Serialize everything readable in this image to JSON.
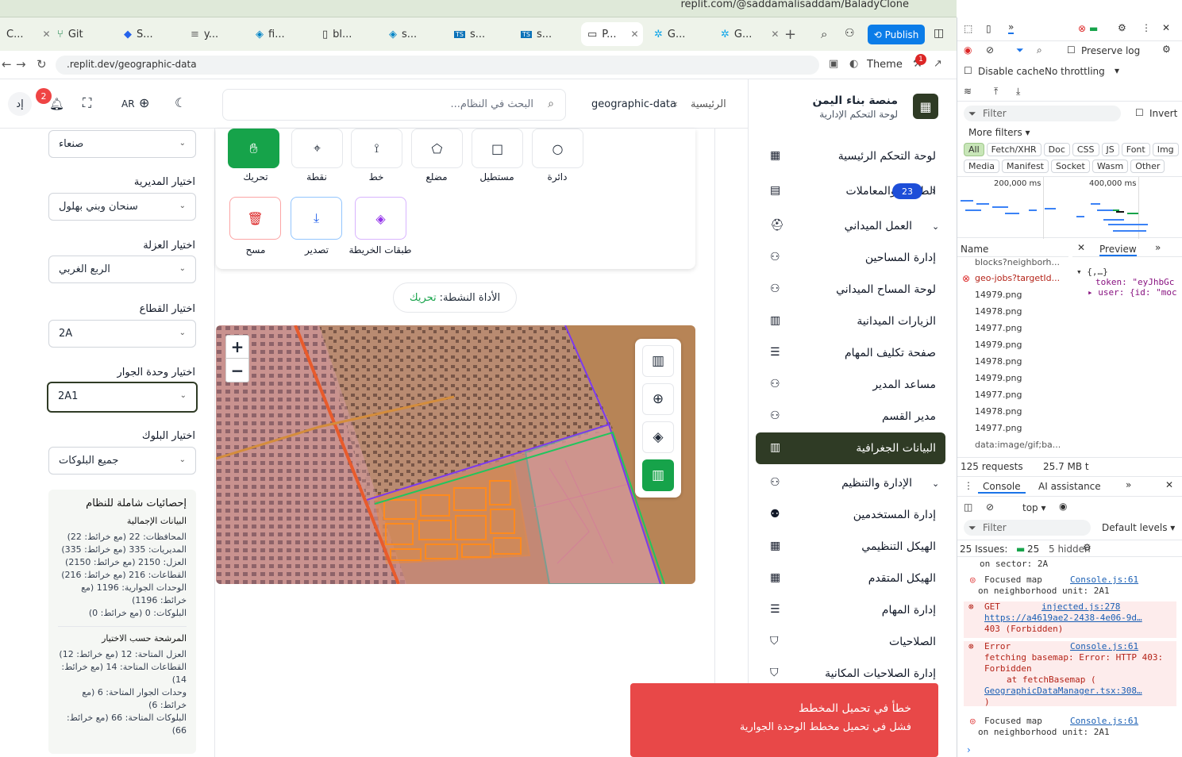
{
  "browser": {
    "url_top": "replit.com/@saddamalisaddam/BaladyClone",
    "tabs": [
      {
        "label": "C..."
      },
      {
        "label": "Git"
      },
      {
        "label": "S..."
      },
      {
        "label": "y..."
      },
      {
        "label": "fi..."
      },
      {
        "label": "bl..."
      },
      {
        "label": "s..."
      },
      {
        "label": "s..."
      },
      {
        "label": "s..."
      },
      {
        "label": "P..."
      },
      {
        "label": "G..."
      },
      {
        "label": "G..."
      }
    ],
    "publish": "Publish",
    "address": ".replit.dev/geographic-data",
    "theme": "Theme",
    "badge": "1"
  },
  "header": {
    "breadcrumb_home": "الرئيسية",
    "breadcrumb_current": "geographic-data",
    "search_placeholder": "البحث في النظام...",
    "lang": "AR",
    "notif_count": "2",
    "avatar": "إد"
  },
  "sidebar": {
    "brand_title": "منصة بناء اليمن",
    "brand_sub": "لوحة التحكم الإدارية",
    "items": [
      {
        "label": "لوحة التحكم الرئيسية"
      },
      {
        "label": "الطلبات والمعاملات",
        "badge": "23"
      },
      {
        "label": "العمل الميداني"
      },
      {
        "label": "إدارة المساحين"
      },
      {
        "label": "لوحة المساح الميداني"
      },
      {
        "label": "الزيارات الميدانية"
      },
      {
        "label": "صفحة تكليف المهام"
      },
      {
        "label": "مساعد المدير"
      },
      {
        "label": "مدير القسم"
      },
      {
        "label": "البيانات الجغرافية"
      },
      {
        "label": "الإدارة والتنظيم"
      },
      {
        "label": "إدارة المستخدمين"
      },
      {
        "label": "الهيكل التنظيمي"
      },
      {
        "label": "الهيكل المتقدم"
      },
      {
        "label": "إدارة المهام"
      },
      {
        "label": "الصلاحيات"
      },
      {
        "label": "إدارة الصلاحيات المكانية"
      }
    ]
  },
  "filters": {
    "governorate_value": "صنعاء",
    "district_label": "اختيار المديرية",
    "district_value": "سنحان وبني بهلول",
    "uzla_label": "اختيار العزلة",
    "uzla_value": "الربع الغربي",
    "sector_label": "اختيار القطاع",
    "sector_value": "2A",
    "unit_label": "اختيار وحدة الجوار",
    "unit_value": "2A1",
    "block_label": "اختيار البلوك",
    "block_value": "جميع البلوكات"
  },
  "stats": {
    "title": "إحصائيات شاملة للنظام",
    "total_title": "البيانات الإجمالية",
    "total_lines": [
      "المحافظات: 22 (مع خرائط: 22)",
      "المديريات: 335 (مع خرائط: 335)",
      "العزل: 2150 (مع خرائط: 2150)",
      "القطاعات: 216 (مع خرائط: 216)",
      "الوحدات الجوارية: 1196 (مع خرائط: 1196)",
      "البلوكات: 0 (مع خرائط: 0)"
    ],
    "filtered_title": "المرشحة حسب الاختيار",
    "filtered_lines": [
      "العزل المتاحة: 12 (مع خرائط: 12)",
      "القطاعات المتاحة: 14 (مع خرائط: 14)",
      "وحدات الجوار المتاحة: 6 (مع خرائط: 6)",
      "البلوكات المتاحة: 66 (مع خرائط: 66)"
    ]
  },
  "tools": {
    "row1": [
      "تحريك",
      "نقطة",
      "خط",
      "مضلع",
      "مستطيل",
      "دائرة"
    ],
    "row2": [
      "مسح",
      "تصدير",
      "طبقات الخريطة"
    ],
    "active_label": "الأداة النشطة:",
    "active_value": "تحريك"
  },
  "map": {
    "zoom_in": "+",
    "zoom_out": "−"
  },
  "toast": {
    "title": "خطأ في تحميل المخطط",
    "message": "فشل في تحميل مخطط الوحدة الجوارية"
  },
  "devtools": {
    "preserve_log": "Preserve log",
    "disable_cache": "Disable cache",
    "throttling": "No throttling",
    "filter": "Filter",
    "invert": "Invert",
    "more_filters": "More filters",
    "types": [
      "All",
      "Fetch/XHR",
      "Doc",
      "CSS",
      "JS",
      "Font",
      "Img",
      "Media",
      "Manifest",
      "Socket",
      "Wasm",
      "Other"
    ],
    "timeline_ticks": [
      "200,000 ms",
      "400,000 ms"
    ],
    "name_header": "Name",
    "preview_tab": "Preview",
    "requests": [
      "blocks?neighborh...",
      "geo-jobs?targetId...",
      "14979.png",
      "14978.png",
      "14977.png",
      "14979.png",
      "14978.png",
      "14979.png",
      "14977.png",
      "14978.png",
      "14977.png",
      "data:image/gif;ba..."
    ],
    "preview_lines": [
      "{,…}",
      "token: \"eyJhbGc",
      "user: {id: \"moc"
    ],
    "summary_requests": "125 requests",
    "summary_size": "25.7 MB t",
    "console_tab": "Console",
    "ai_tab": "AI assistance",
    "top": "top",
    "default_levels": "Default levels",
    "issues": "25 Issues:",
    "issues_count": "25",
    "hidden": "5 hidden",
    "log": [
      {
        "text": "on sector: 2A"
      },
      {
        "text": "Focused map",
        "link": "Console.js:61",
        "text2": "on neighborhood unit: 2A1"
      },
      {
        "text": "GET",
        "link": "injected.js:278",
        "url": "https://a4619ae2-2438-4e06-9d…",
        "text2": "403 (Forbidden)"
      },
      {
        "text": "Error",
        "link": "Console.js:61",
        "text2": "fetching basemap: Error: HTTP 403: Forbidden",
        "text3": "at fetchBasemap (",
        "url": "GeographicDataManager.tsx:308…",
        "text4": ")"
      },
      {
        "text": "Focused map",
        "link": "Console.js:61",
        "text2": "on neighborhood unit: 2A1"
      }
    ]
  }
}
